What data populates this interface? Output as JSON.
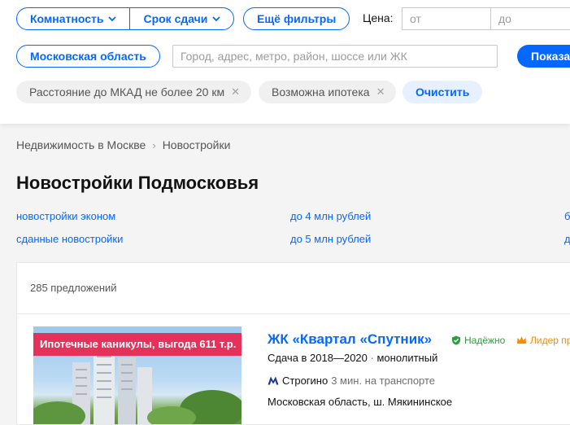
{
  "filters": {
    "rooms_label": "Комнатность",
    "deadline_label": "Срок сдачи",
    "more_filters_label": "Ещё фильтры",
    "price_label": "Цена:",
    "price_from_placeholder": "от",
    "price_to_placeholder": "до",
    "region_label": "Московская область",
    "search_placeholder": "Город, адрес, метро, район, шоссе или ЖК",
    "show_label": "Показать",
    "tags": [
      {
        "label": "Расстояние до МКАД не более 20 км"
      },
      {
        "label": "Возможна ипотека"
      }
    ],
    "clear_label": "Очистить"
  },
  "breadcrumbs": [
    {
      "label": "Недвижимость в Москве"
    },
    {
      "label": "Новостройки"
    }
  ],
  "page_title": "Новостройки Подмосковья",
  "quick_links": [
    {
      "label": "новостройки эконом"
    },
    {
      "label": "до 4 млн рублей"
    },
    {
      "label": "б"
    },
    {
      "label": "сданные новостройки"
    },
    {
      "label": "до 5 млн рублей"
    },
    {
      "label": "д"
    }
  ],
  "results": {
    "count_text": "285 предложений"
  },
  "listing": {
    "promo": "Ипотечные каникулы, выгода 611 т.р.",
    "title": "ЖК «Квартал «Спутник»",
    "badge_reliable": "Надёжно",
    "badge_leader": "Лидер пр",
    "deadline": "Сдача в 2018—2020",
    "material": "монолитный",
    "metro_station": "Строгино",
    "metro_time": "3 мин. на транспорте",
    "address": "Московская область, ш. Мякининское"
  },
  "colors": {
    "accent": "#0468ff",
    "promo": "#e5325a",
    "reliable": "#2e9e3e",
    "leader": "#f28c00",
    "metro": "#1d3a8c"
  }
}
